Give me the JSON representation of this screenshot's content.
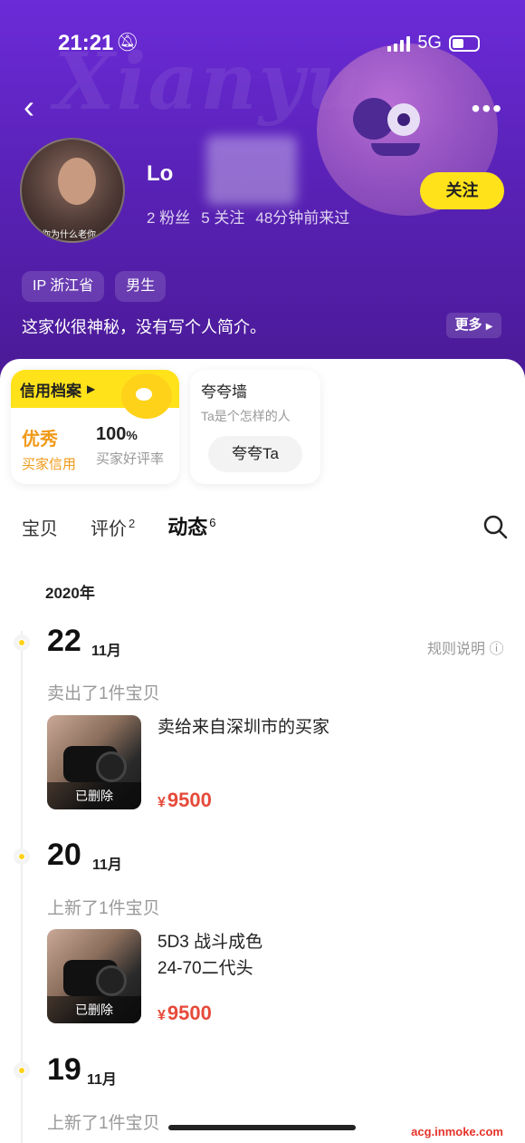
{
  "status_bar": {
    "time": "21:21",
    "network": "5G"
  },
  "header": {
    "wordmark": "Xianyu",
    "username": "Lo",
    "stats": {
      "fans": "2 粉丝",
      "following": "5 关注",
      "last_seen": "48分钟前来过"
    },
    "follow_label": "关注",
    "avatar_caption": "你为什么老你",
    "tags": [
      "IP 浙江省",
      "男生"
    ],
    "bio": "这家伙很神秘，没有写个人简介。",
    "more_label": "更多"
  },
  "credit_card": {
    "title": "信用档案",
    "rating_value": "优秀",
    "rating_label": "买家信用",
    "praise_value": "100",
    "praise_unit": "%",
    "praise_label": "买家好评率"
  },
  "praise_wall": {
    "title": "夸夸墙",
    "subtitle": "Ta是个怎样的人",
    "button": "夸夸Ta"
  },
  "tabs": [
    {
      "label": "宝贝",
      "count": ""
    },
    {
      "label": "评价",
      "count": "2"
    },
    {
      "label": "动态",
      "count": "6"
    }
  ],
  "timeline": {
    "year": "2020年",
    "rule_link": "规则说明",
    "entries": [
      {
        "day": "22",
        "month": "11月",
        "event": "卖出了1件宝贝",
        "item_title_1": "卖给来自深圳市的买家",
        "item_title_2": "",
        "badge": "已删除",
        "price": "9500"
      },
      {
        "day": "20",
        "month": "11月",
        "event": "上新了1件宝贝",
        "item_title_1": "5D3 战斗成色",
        "item_title_2": "24-70二代头",
        "badge": "已删除",
        "price": "9500"
      },
      {
        "day": "19",
        "month": "11月",
        "event": "上新了1件宝贝"
      }
    ]
  },
  "watermark": "acg.inmoke.com",
  "colors": {
    "accent_yellow": "#ffe21a",
    "price_red": "#e64a3a",
    "header_purple": "#5a22b8"
  }
}
